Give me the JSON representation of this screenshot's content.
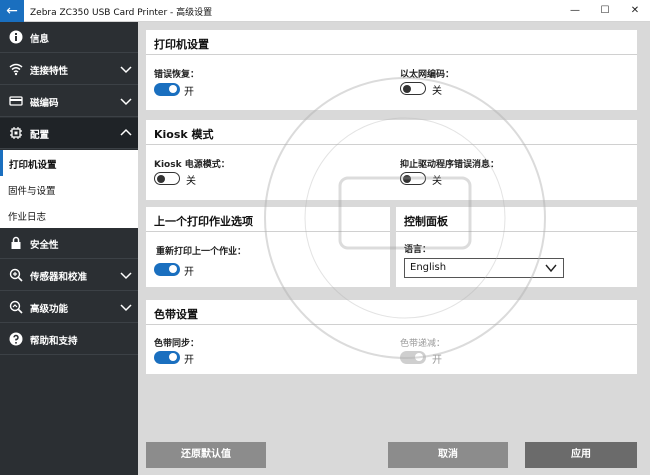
{
  "window": {
    "title": "Zebra ZC350 USB Card Printer - 高级设置",
    "back_icon": "arrow-left-icon",
    "minimize": "—",
    "maximize": "☐",
    "close": "✕"
  },
  "sidebar": {
    "items": [
      {
        "label": "信息",
        "icon": "info-icon"
      },
      {
        "label": "连接特性",
        "icon": "wifi-icon"
      },
      {
        "label": "磁编码",
        "icon": "card-icon"
      },
      {
        "label": "配置",
        "icon": "chip-icon"
      },
      {
        "label": "安全性",
        "icon": "lock-icon"
      },
      {
        "label": "传感器和校准",
        "icon": "sensor-icon"
      },
      {
        "label": "高级功能",
        "icon": "advanced-icon"
      },
      {
        "label": "帮助和支持",
        "icon": "help-icon"
      }
    ],
    "sub_items": [
      {
        "label": "打印机设置"
      },
      {
        "label": "固件与设置"
      },
      {
        "label": "作业日志"
      }
    ]
  },
  "printer_settings": {
    "title": "打印机设置",
    "error_recovery": {
      "label": "错误恢复：",
      "state": "开"
    },
    "ethernet_encoding": {
      "label": "以太网编码：",
      "state": "关"
    }
  },
  "kiosk": {
    "title": "Kiosk 模式",
    "power_mode": {
      "label": "Kiosk 电源模式：",
      "state": "关"
    },
    "suppress_driver_errors": {
      "label": "抑止驱动程序错误消息：",
      "state": "关"
    }
  },
  "last_job": {
    "title": "上一个打印作业选项",
    "reprint": {
      "label": "重新打印上一个作业：",
      "state": "开"
    }
  },
  "control_panel": {
    "title": "控制面板",
    "language_label": "语言：",
    "language_value": "English"
  },
  "ribbon": {
    "title": "色带设置",
    "sync": {
      "label": "色带同步：",
      "state": "开"
    },
    "low": {
      "label": "色带递减：",
      "state": "开"
    }
  },
  "footer": {
    "restore_defaults": "还原默认值",
    "cancel": "取消",
    "apply": "应用"
  },
  "colors": {
    "accent": "#1a6fbf",
    "sidebar_bg": "#2b2f33",
    "content_bg": "#d9d9d9"
  }
}
